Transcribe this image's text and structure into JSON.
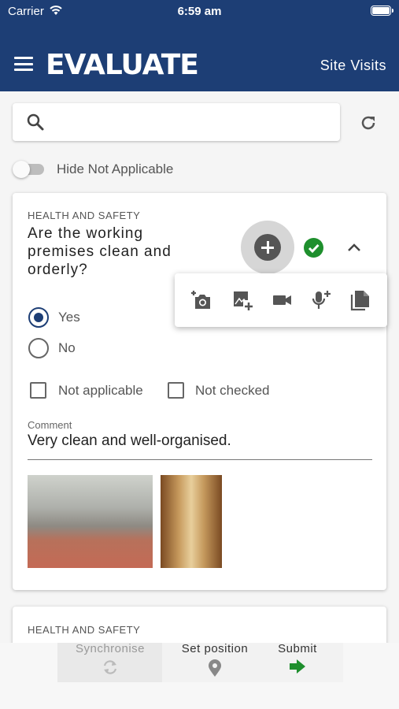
{
  "status_bar": {
    "carrier": "Carrier",
    "time": "6:59 am"
  },
  "header": {
    "logo": "EVALUATE",
    "section_title": "Site Visits"
  },
  "search": {
    "placeholder": ""
  },
  "filter": {
    "hide_not_applicable_label": "Hide Not Applicable",
    "hide_not_applicable_on": false
  },
  "questions": [
    {
      "category": "HEALTH AND SAFETY",
      "text": "Are the working premises clean and orderly?",
      "answers": [
        {
          "label": "Yes",
          "selected": true
        },
        {
          "label": "No",
          "selected": false
        }
      ],
      "options": [
        {
          "label": "Not applicable",
          "checked": false
        },
        {
          "label": "Not checked",
          "checked": false
        }
      ],
      "comment_label": "Comment",
      "comment": "Very clean and well-organised.",
      "photos": [
        "winery-tanks-photo",
        "wine-barrels-photo"
      ],
      "completed": true
    },
    {
      "category": "HEALTH AND SAFETY",
      "completed": true
    }
  ],
  "attach_menu": [
    "add-photo-icon",
    "add-image-icon",
    "video-icon",
    "add-voice-icon",
    "document-icon"
  ],
  "bottom_bar": {
    "synchronise": "Synchronise",
    "set_position": "Set position",
    "submit": "Submit"
  },
  "colors": {
    "header": "#1d3e75",
    "success": "#1e8f2d"
  }
}
